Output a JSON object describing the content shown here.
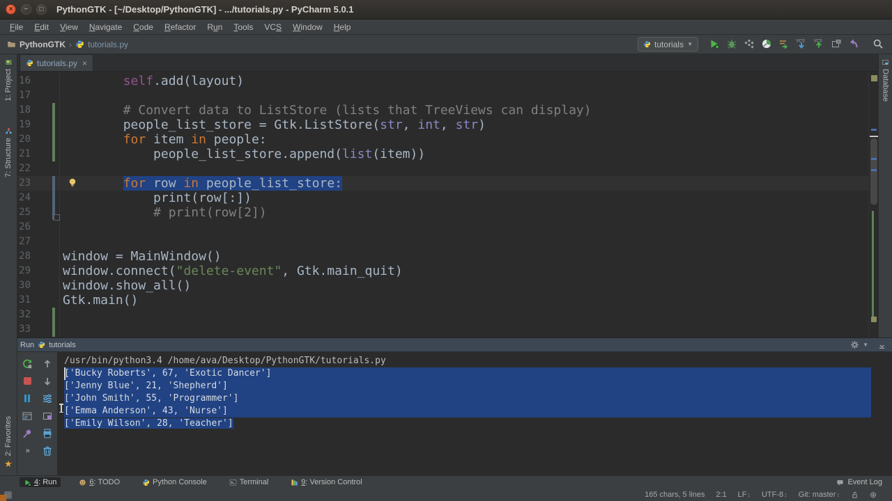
{
  "colors": {
    "selection_blue": "#214283",
    "keyword_orange": "#cc7832",
    "string_green": "#6a8759",
    "comment_gray": "#808080",
    "builtin_purple": "#8888c6",
    "self_purple": "#94558d",
    "default_code": "#a9b7c6",
    "run_green": "#4db34d",
    "stop_red": "#c75450",
    "vcs_added_green": "#5d8157",
    "vcs_modified_blue": "#51657a"
  },
  "title_bar": {
    "title": "PythonGTK - [~/Desktop/PythonGTK] - .../tutorials.py - PyCharm 5.0.1"
  },
  "menu_bar": {
    "items": [
      {
        "label": "File",
        "u": 0
      },
      {
        "label": "Edit",
        "u": 0
      },
      {
        "label": "View",
        "u": 0
      },
      {
        "label": "Navigate",
        "u": 0
      },
      {
        "label": "Code",
        "u": 0
      },
      {
        "label": "Refactor",
        "u": 0
      },
      {
        "label": "Run",
        "u": 1
      },
      {
        "label": "Tools",
        "u": 0
      },
      {
        "label": "VCS",
        "u": 2
      },
      {
        "label": "Window",
        "u": 0
      },
      {
        "label": "Help",
        "u": 0
      }
    ]
  },
  "navbar": {
    "breadcrumbs": [
      {
        "label": "PythonGTK",
        "icon": "folder-icon"
      },
      {
        "label": "tutorials.py",
        "icon": "python-icon"
      }
    ],
    "run_config": {
      "label": "tutorials",
      "icon": "python-run-config-icon"
    },
    "tools": [
      "run",
      "debug",
      "coverage",
      "profile",
      "run-settings",
      "vcs-update",
      "vcs-commit",
      "diff",
      "rollback",
      "sep",
      "search"
    ]
  },
  "left_stripe": {
    "project_label": "1: Project",
    "structure_label": "7: Structure",
    "favorites_label": "2: Favorites"
  },
  "right_stripe": {
    "database_label": "Database"
  },
  "editor": {
    "tab": {
      "label": "tutorials.py",
      "close_glyph": "×"
    },
    "lines": [
      {
        "n": 16,
        "tokens": [
          [
            "d",
            "        "
          ],
          [
            "f",
            "self"
          ],
          [
            "d",
            ".add(layout)"
          ]
        ]
      },
      {
        "n": 17,
        "tokens": []
      },
      {
        "n": 18,
        "tokens": [
          [
            "c",
            "        # Convert data to ListStore (lists that TreeViews can display)"
          ]
        ]
      },
      {
        "n": 19,
        "tokens": [
          [
            "d",
            "        people_list_store = Gtk.ListStore("
          ],
          [
            "b",
            "str"
          ],
          [
            "d",
            ", "
          ],
          [
            "b",
            "int"
          ],
          [
            "d",
            ", "
          ],
          [
            "b",
            "str"
          ],
          [
            "d",
            ")"
          ]
        ]
      },
      {
        "n": 20,
        "tokens": [
          [
            "d",
            "        "
          ],
          [
            "k",
            "for"
          ],
          [
            "d",
            " item "
          ],
          [
            "k",
            "in"
          ],
          [
            "d",
            " people:"
          ]
        ]
      },
      {
        "n": 21,
        "tokens": [
          [
            "d",
            "            people_list_store.append("
          ],
          [
            "b",
            "list"
          ],
          [
            "d",
            "(item))"
          ]
        ]
      },
      {
        "n": 22,
        "tokens": []
      },
      {
        "n": 23,
        "current": true,
        "tokens": [
          [
            "d",
            "        "
          ]
        ],
        "sel_tokens": [
          [
            "k",
            "for"
          ],
          [
            "d",
            " row "
          ],
          [
            "k",
            "in"
          ],
          [
            "d",
            " people_list_store:"
          ]
        ]
      },
      {
        "n": 24,
        "tokens": [
          [
            "d",
            "            print(row[:])"
          ]
        ]
      },
      {
        "n": 25,
        "tokens": [
          [
            "c",
            "            # print(row[2])"
          ]
        ]
      },
      {
        "n": 26,
        "tokens": []
      },
      {
        "n": 27,
        "tokens": []
      },
      {
        "n": 28,
        "tokens": [
          [
            "d",
            "window = MainWindow()"
          ]
        ]
      },
      {
        "n": 29,
        "tokens": [
          [
            "d",
            "window.connect("
          ],
          [
            "s",
            "\"delete-event\""
          ],
          [
            "d",
            ", Gtk.main_quit)"
          ]
        ]
      },
      {
        "n": 30,
        "tokens": [
          [
            "d",
            "window.show_all()"
          ]
        ]
      },
      {
        "n": 31,
        "tokens": [
          [
            "d",
            "Gtk.main()"
          ]
        ]
      },
      {
        "n": 32,
        "tokens": []
      },
      {
        "n": 33,
        "tokens": []
      }
    ],
    "change_bars": [
      {
        "from": 18,
        "to": 21,
        "type": "added"
      },
      {
        "from": 23,
        "to": 25,
        "type": "modified"
      },
      {
        "from": 32,
        "to": 33,
        "type": "added"
      }
    ],
    "lightbulb_line": 23,
    "fold_marker_line": 25
  },
  "run_panel": {
    "header": {
      "tool_label": "Run",
      "config_label": "tutorials"
    },
    "toolbar_col1": [
      "rerun",
      "stop",
      "pause",
      "console-layout",
      "pin",
      "more"
    ],
    "toolbar_col2": [
      "up",
      "down",
      "filter",
      "window-purple",
      "printer",
      "trash"
    ],
    "console": {
      "command_line": "/usr/bin/python3.4 /home/ava/Desktop/PythonGTK/tutorials.py",
      "output_lines": [
        "['Bucky Roberts', 67, 'Exotic Dancer']",
        "['Jenny Blue', 21, 'Shepherd']",
        "['John Smith', 55, 'Programmer']",
        "['Emma Anderson', 43, 'Nurse']",
        "['Emily Wilson', 28, 'Teacher']"
      ]
    }
  },
  "toolwindow_bar": {
    "items": [
      {
        "label": "4: Run",
        "u": 0,
        "icon": "run",
        "active": true
      },
      {
        "label": "6: TODO",
        "u": 0,
        "icon": "todo",
        "active": false
      },
      {
        "label": "Python Console",
        "icon": "python",
        "active": false
      },
      {
        "label": "Terminal",
        "icon": "terminal",
        "active": false
      },
      {
        "label": "9: Version Control",
        "u": 0,
        "icon": "vcs-tool",
        "active": false
      }
    ],
    "event_log": "Event Log"
  },
  "status_bar": {
    "selection_info": "165 chars, 5 lines",
    "caret": "2:1",
    "line_ending": "LF",
    "encoding": "UTF-8",
    "vcs_branch": "Git: master"
  }
}
